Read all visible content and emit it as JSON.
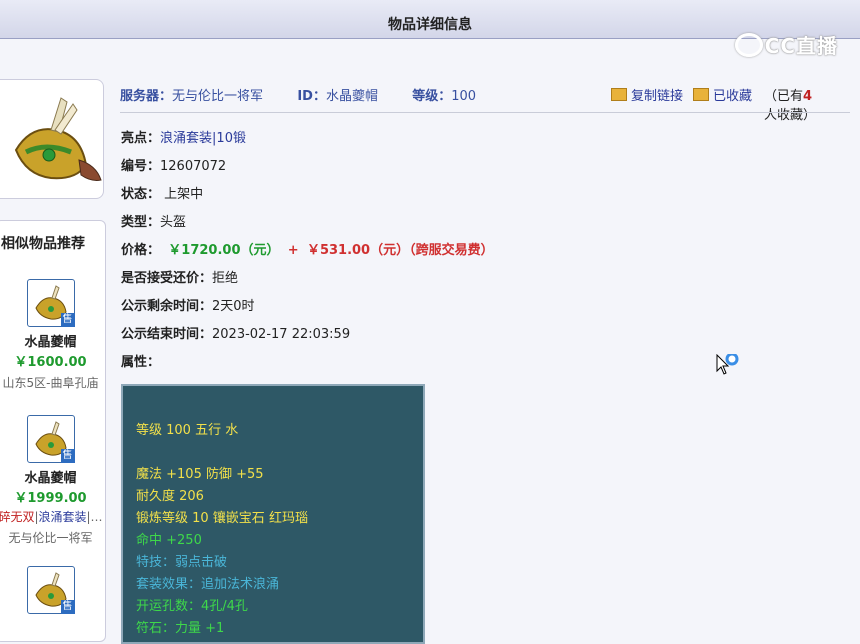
{
  "title": "物品详细信息",
  "watermark": "CC直播",
  "header": {
    "server_label": "服务器：",
    "server_value": "无与伦比一将军",
    "id_label": "ID：",
    "id_value": "水晶夔帽",
    "level_label": "等级：",
    "level_value": "100",
    "copy_link": "复制链接",
    "favorited": "已收藏",
    "fav_prefix": "（已有",
    "fav_count": "4",
    "fav_suffix": "人收藏）"
  },
  "details": {
    "highlight_label": "亮点：",
    "highlight_1": "浪涌套装",
    "highlight_2": "10锻",
    "number_label": "编号：",
    "number_value": "12607072",
    "status_label": "状态：",
    "status_value": "上架中",
    "type_label": "类型：",
    "type_value": "头盔",
    "price_label": "价格：",
    "price_value": "￥1720.00（元）",
    "price_plus": "+",
    "fee_value": "￥531.00（元）（跨服交易费）",
    "bargain_label": "是否接受还价：",
    "bargain_value": "拒绝",
    "remain_label": "公示剩余时间：",
    "remain_value": "2天0时",
    "end_label": "公示结束时间：",
    "end_value": "2023-02-17 22:03:59",
    "attr_label": "属性："
  },
  "attributes": {
    "line1": "等级 100 五行 水",
    "line2": "魔法 +105 防御 +55",
    "line3": "耐久度 206",
    "line4": "锻炼等级 10 镶嵌宝石 红玛瑙",
    "line5": "命中 +250",
    "line6": "特技：弱点击破",
    "line7": "套装效果：追加法术浪涌",
    "line8": "开运孔数：4孔/4孔",
    "line9": "符石：力量 +1"
  },
  "sidebar": {
    "title": "相似物品推荐",
    "items": [
      {
        "name": "水晶夔帽",
        "price": "￥1600.00",
        "sub": "山东5区-曲阜孔庙",
        "badge": "售"
      },
      {
        "name": "水晶夔帽",
        "price": "￥1999.00",
        "sub_red": "碎无双",
        "sub_sep": "|",
        "sub_blue": "浪涌套装",
        "sub_more": "|…",
        "sub2": "无与伦比一将军",
        "badge": "售"
      },
      {
        "name": "",
        "price": "",
        "badge": "售"
      }
    ]
  },
  "colors": {
    "price_green": "#1e9a2e",
    "fee_red": "#d03030",
    "attr_bg": "#2e5866",
    "attr_yellow": "#f2e04a",
    "attr_green": "#3ed84a",
    "attr_cyan": "#4ab6d8"
  }
}
